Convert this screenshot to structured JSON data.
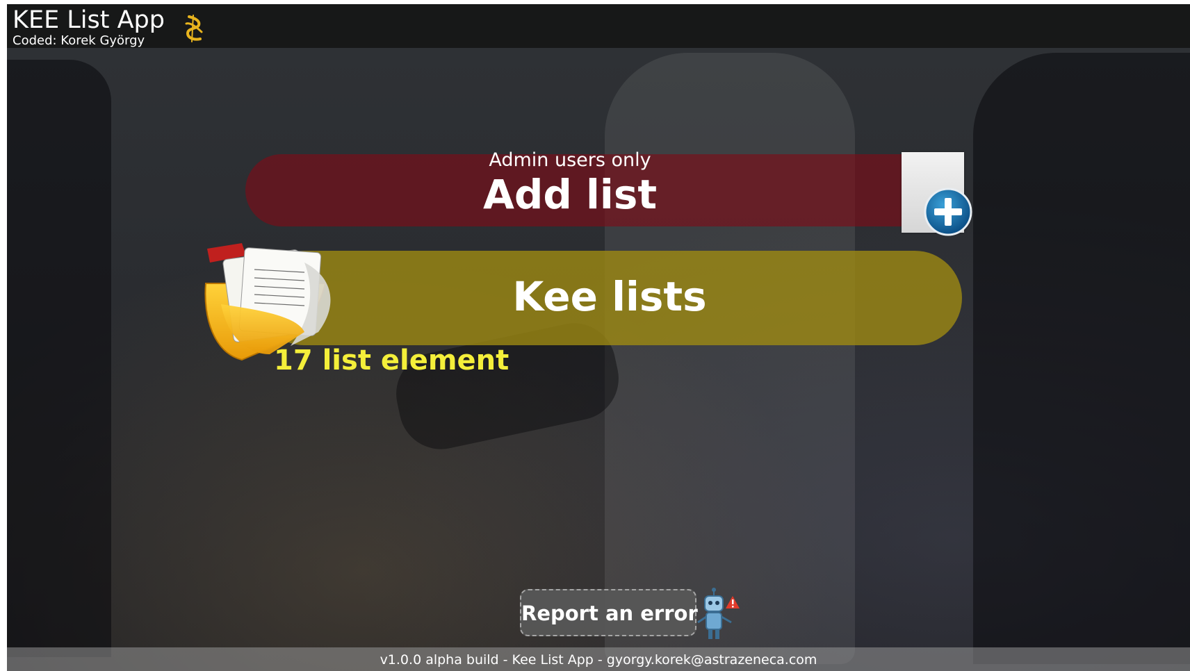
{
  "header": {
    "title": "KEE List App",
    "subtitle": "Coded: Korek György",
    "logo_icon": "astrazeneca-logo-icon"
  },
  "main": {
    "add_list": {
      "subtitle": "Admin users only",
      "label": "Add list",
      "icon": "add-document-plus-icon",
      "color": "#800c16"
    },
    "kee_lists": {
      "label": "Kee lists",
      "icon": "documents-folder-icon",
      "count_text": "17 list element",
      "color": "#a08c12"
    }
  },
  "report": {
    "label": "Report an error",
    "icon": "robot-warning-icon"
  },
  "footer": {
    "text": "v1.0.0 alpha build - Kee List App - gyorgy.korek@astrazeneca.com"
  }
}
